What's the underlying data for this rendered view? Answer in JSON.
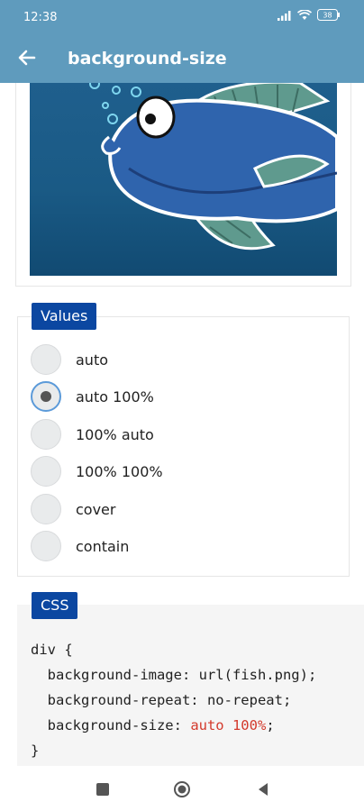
{
  "status": {
    "time": "12:38",
    "battery": "38"
  },
  "appbar": {
    "title": "background-size"
  },
  "values": {
    "legend": "Values",
    "options": [
      "auto",
      "auto 100%",
      "100% auto",
      "100% 100%",
      "cover",
      "contain"
    ],
    "selected": "auto 100%"
  },
  "css": {
    "legend": "CSS",
    "line1": "div {",
    "line2": "  background-image: url(fish.png);",
    "line3": "  background-repeat: no-repeat;",
    "line4_prop": "  background-size: ",
    "line4_value": "auto 100%",
    "line4_end": ";",
    "line5": "}"
  },
  "colors": {
    "appbar": "#5f9bbd",
    "legend": "#0b47a1",
    "code_value": "#d33a2c"
  }
}
